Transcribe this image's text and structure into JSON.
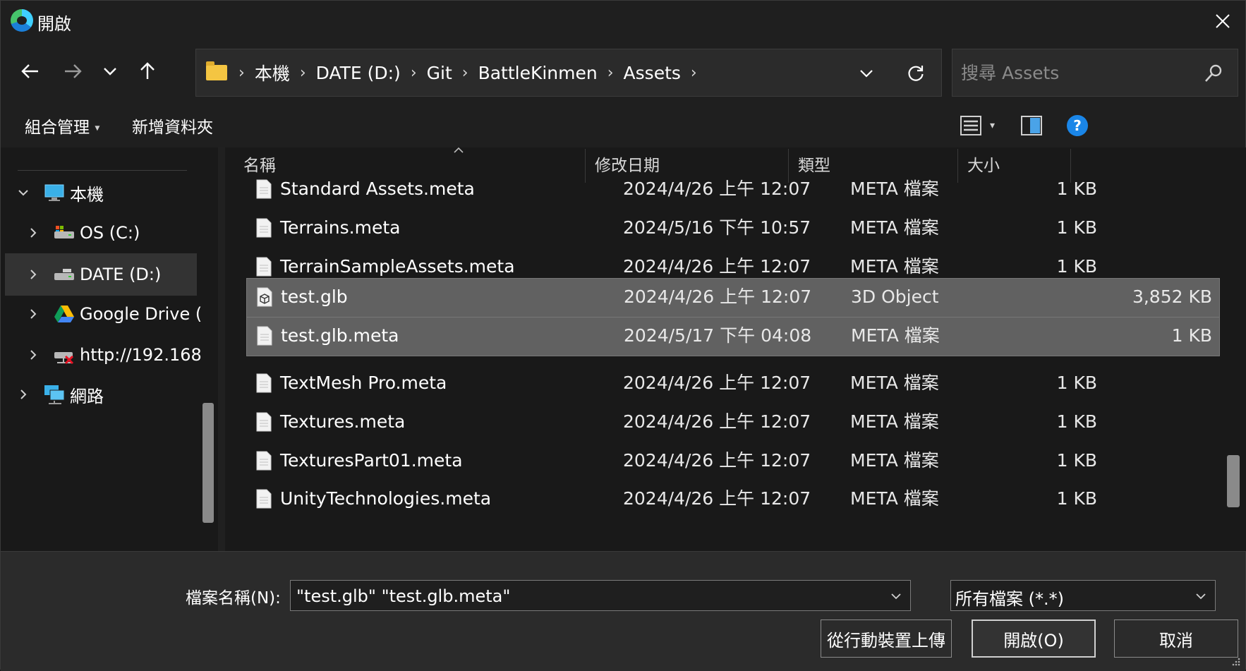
{
  "window": {
    "title": "開啟"
  },
  "nav": {
    "breadcrumb": [
      "本機",
      "DATE (D:)",
      "Git",
      "BattleKinmen",
      "Assets"
    ],
    "search_placeholder": "搜尋 Assets"
  },
  "toolbar": {
    "organize": "組合管理",
    "new_folder": "新增資料夾"
  },
  "sidebar": {
    "items": [
      {
        "label": "本機",
        "icon": "computer-icon",
        "expanded": true
      },
      {
        "label": "OS (C:)",
        "icon": "drive-icon"
      },
      {
        "label": "DATE (D:)",
        "icon": "drive-icon",
        "selected": true
      },
      {
        "label": "Google Drive (",
        "icon": "google-drive-icon"
      },
      {
        "label": "http://192.168",
        "icon": "network-drive-disconnected-icon"
      },
      {
        "label": "網路",
        "icon": "network-icon"
      }
    ]
  },
  "list": {
    "columns": {
      "name": "名稱",
      "modified": "修改日期",
      "type": "類型",
      "size": "大小"
    },
    "rows": [
      {
        "name": "Standard Assets.meta",
        "modified": "2024/4/26 上午 12:07",
        "type": "META 檔案",
        "size": "1 KB"
      },
      {
        "name": "Terrains.meta",
        "modified": "2024/5/16 下午 10:57",
        "type": "META 檔案",
        "size": "1 KB"
      },
      {
        "name": "TerrainSampleAssets.meta",
        "modified": "2024/4/26 上午 12:07",
        "type": "META 檔案",
        "size": "1 KB"
      },
      {
        "name": "test.glb",
        "modified": "2024/4/26 上午 12:07",
        "type": "3D Object",
        "size": "3,852 KB",
        "selected": true
      },
      {
        "name": "test.glb.meta",
        "modified": "2024/5/17 下午 04:08",
        "type": "META 檔案",
        "size": "1 KB",
        "selected": true
      },
      {
        "name": "TextMesh Pro.meta",
        "modified": "2024/4/26 上午 12:07",
        "type": "META 檔案",
        "size": "1 KB"
      },
      {
        "name": "Textures.meta",
        "modified": "2024/4/26 上午 12:07",
        "type": "META 檔案",
        "size": "1 KB"
      },
      {
        "name": "TexturesPart01.meta",
        "modified": "2024/4/26 上午 12:07",
        "type": "META 檔案",
        "size": "1 KB"
      },
      {
        "name": "UnityTechnologies.meta",
        "modified": "2024/4/26 上午 12:07",
        "type": "META 檔案",
        "size": "1 KB"
      }
    ]
  },
  "footer": {
    "filename_label": "檔案名稱(N):",
    "filename_value": "\"test.glb\" \"test.glb.meta\"",
    "filetype": "所有檔案 (*.*)",
    "upload_button": "從行動裝置上傳",
    "open_button": "開啟(O)",
    "cancel_button": "取消"
  },
  "colors": {
    "background": "#202020",
    "selection": "#616161",
    "accent": "#0078d4"
  }
}
